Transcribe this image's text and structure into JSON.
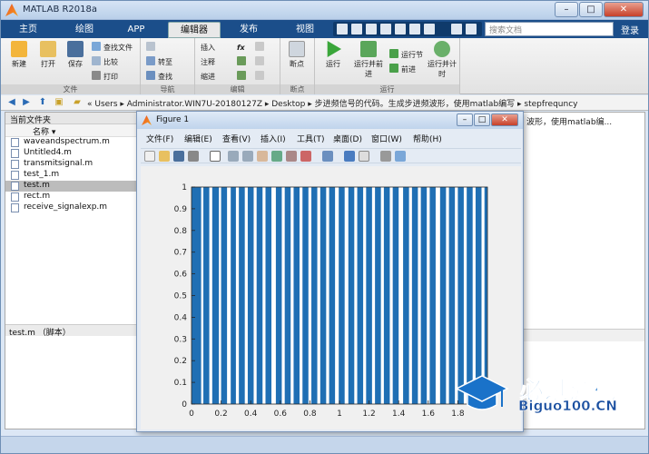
{
  "app": {
    "title": "MATLAB R2018a",
    "win_min": "–",
    "win_max": "□",
    "win_close": "✕"
  },
  "tabs": [
    {
      "label": "主页"
    },
    {
      "label": "绘图"
    },
    {
      "label": "APP"
    },
    {
      "label": "编辑器"
    },
    {
      "label": "发布"
    },
    {
      "label": "视图"
    }
  ],
  "search": {
    "placeholder": "搜索文档"
  },
  "login_label": "登录",
  "ribbon": {
    "file": {
      "label": "文件",
      "new": "新建",
      "open": "打开",
      "save": "保存",
      "find_files": "查找文件",
      "compare": "比较",
      "print": "打印"
    },
    "nav": {
      "label": "导航",
      "goto": "转至",
      "find": "查找"
    },
    "edit": {
      "label": "编辑",
      "insert": "插入",
      "comment": "注释",
      "indent": "缩进",
      "fx": "fx"
    },
    "breakpoints": {
      "label": "断点",
      "btn": "断点"
    },
    "run": {
      "label": "运行",
      "run": "运行",
      "run_advance": "运行并前进",
      "run_section": "运行节",
      "advance": "前进",
      "run_time": "运行并计时"
    }
  },
  "address": {
    "crumbs": "«  Users  ▸  Administrator.WIN7U-20180127Z  ▸  Desktop  ▸  步进频信号的代码。生成步进频波形，使用matlab编写  ▸  stepfrequncy"
  },
  "files": {
    "header": "当前文件夹",
    "col_name": "名称 ▾",
    "items": [
      {
        "name": "waveandspectrum.m",
        "selected": false
      },
      {
        "name": "Untitled4.m",
        "selected": false
      },
      {
        "name": "transmitsignal.m",
        "selected": false
      },
      {
        "name": "test_1.m",
        "selected": false
      },
      {
        "name": "test.m",
        "selected": true
      },
      {
        "name": "rect.m",
        "selected": false
      },
      {
        "name": "receive_signalexp.m",
        "selected": false
      }
    ],
    "footer": "test.m （脚本）"
  },
  "right_panel": {
    "text": "波形，使用matlab编..."
  },
  "figure": {
    "title": "Figure 1",
    "menu": [
      "文件(F)",
      "编辑(E)",
      "查看(V)",
      "插入(I)",
      "工具(T)",
      "桌面(D)",
      "窗口(W)",
      "帮助(H)"
    ]
  },
  "chart_data": {
    "type": "bar",
    "title": "",
    "xlabel": "",
    "ylabel": "",
    "xlim": [
      0,
      2
    ],
    "ylim": [
      0,
      1
    ],
    "xticks": [
      "0",
      "0.2",
      "0.4",
      "0.6",
      "0.8",
      "1",
      "1.2",
      "1.4",
      "1.6",
      "1.8"
    ],
    "yticks": [
      "0",
      "0.1",
      "0.2",
      "0.3",
      "0.4",
      "0.5",
      "0.6",
      "0.7",
      "0.8",
      "0.9",
      "1"
    ],
    "bar_color": "#1f6fb4",
    "segments": [
      [
        0.0,
        0.065
      ],
      [
        0.08,
        0.12
      ],
      [
        0.14,
        0.185
      ],
      [
        0.2,
        0.24
      ],
      [
        0.265,
        0.3
      ],
      [
        0.32,
        0.36
      ],
      [
        0.38,
        0.42
      ],
      [
        0.44,
        0.48
      ],
      [
        0.5,
        0.54
      ],
      [
        0.57,
        0.61
      ],
      [
        0.63,
        0.67
      ],
      [
        0.69,
        0.73
      ],
      [
        0.75,
        0.79
      ],
      [
        0.81,
        0.85
      ],
      [
        0.87,
        0.91
      ],
      [
        0.93,
        0.97
      ],
      [
        0.995,
        1.035
      ],
      [
        1.06,
        1.1
      ],
      [
        1.12,
        1.16
      ],
      [
        1.18,
        1.22
      ],
      [
        1.24,
        1.28
      ],
      [
        1.3,
        1.34
      ],
      [
        1.36,
        1.4
      ],
      [
        1.43,
        1.47
      ],
      [
        1.49,
        1.53
      ],
      [
        1.55,
        1.59
      ],
      [
        1.61,
        1.65
      ],
      [
        1.68,
        1.72
      ],
      [
        1.74,
        1.78
      ],
      [
        1.8,
        1.84
      ],
      [
        1.86,
        1.9
      ],
      [
        1.92,
        1.96
      ],
      [
        1.98,
        2.0
      ]
    ],
    "segment_value": 1
  },
  "watermark": {
    "cn": "必过源码",
    "en": "Biguo100.CN"
  }
}
